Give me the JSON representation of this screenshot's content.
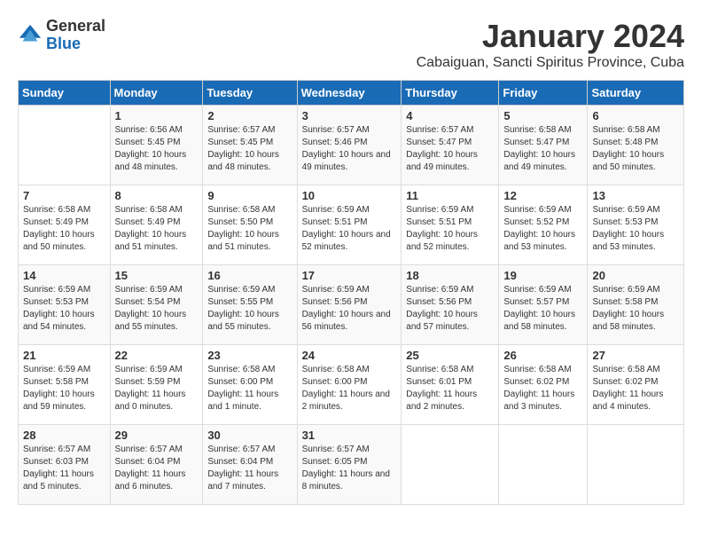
{
  "logo": {
    "general": "General",
    "blue": "Blue"
  },
  "title": "January 2024",
  "subtitle": "Cabaiguan, Sancti Spiritus Province, Cuba",
  "days_header": [
    "Sunday",
    "Monday",
    "Tuesday",
    "Wednesday",
    "Thursday",
    "Friday",
    "Saturday"
  ],
  "weeks": [
    [
      {
        "day": "",
        "sunrise": "",
        "sunset": "",
        "daylight": ""
      },
      {
        "day": "1",
        "sunrise": "Sunrise: 6:56 AM",
        "sunset": "Sunset: 5:45 PM",
        "daylight": "Daylight: 10 hours and 48 minutes."
      },
      {
        "day": "2",
        "sunrise": "Sunrise: 6:57 AM",
        "sunset": "Sunset: 5:45 PM",
        "daylight": "Daylight: 10 hours and 48 minutes."
      },
      {
        "day": "3",
        "sunrise": "Sunrise: 6:57 AM",
        "sunset": "Sunset: 5:46 PM",
        "daylight": "Daylight: 10 hours and 49 minutes."
      },
      {
        "day": "4",
        "sunrise": "Sunrise: 6:57 AM",
        "sunset": "Sunset: 5:47 PM",
        "daylight": "Daylight: 10 hours and 49 minutes."
      },
      {
        "day": "5",
        "sunrise": "Sunrise: 6:58 AM",
        "sunset": "Sunset: 5:47 PM",
        "daylight": "Daylight: 10 hours and 49 minutes."
      },
      {
        "day": "6",
        "sunrise": "Sunrise: 6:58 AM",
        "sunset": "Sunset: 5:48 PM",
        "daylight": "Daylight: 10 hours and 50 minutes."
      }
    ],
    [
      {
        "day": "7",
        "sunrise": "Sunrise: 6:58 AM",
        "sunset": "Sunset: 5:49 PM",
        "daylight": "Daylight: 10 hours and 50 minutes."
      },
      {
        "day": "8",
        "sunrise": "Sunrise: 6:58 AM",
        "sunset": "Sunset: 5:49 PM",
        "daylight": "Daylight: 10 hours and 51 minutes."
      },
      {
        "day": "9",
        "sunrise": "Sunrise: 6:58 AM",
        "sunset": "Sunset: 5:50 PM",
        "daylight": "Daylight: 10 hours and 51 minutes."
      },
      {
        "day": "10",
        "sunrise": "Sunrise: 6:59 AM",
        "sunset": "Sunset: 5:51 PM",
        "daylight": "Daylight: 10 hours and 52 minutes."
      },
      {
        "day": "11",
        "sunrise": "Sunrise: 6:59 AM",
        "sunset": "Sunset: 5:51 PM",
        "daylight": "Daylight: 10 hours and 52 minutes."
      },
      {
        "day": "12",
        "sunrise": "Sunrise: 6:59 AM",
        "sunset": "Sunset: 5:52 PM",
        "daylight": "Daylight: 10 hours and 53 minutes."
      },
      {
        "day": "13",
        "sunrise": "Sunrise: 6:59 AM",
        "sunset": "Sunset: 5:53 PM",
        "daylight": "Daylight: 10 hours and 53 minutes."
      }
    ],
    [
      {
        "day": "14",
        "sunrise": "Sunrise: 6:59 AM",
        "sunset": "Sunset: 5:53 PM",
        "daylight": "Daylight: 10 hours and 54 minutes."
      },
      {
        "day": "15",
        "sunrise": "Sunrise: 6:59 AM",
        "sunset": "Sunset: 5:54 PM",
        "daylight": "Daylight: 10 hours and 55 minutes."
      },
      {
        "day": "16",
        "sunrise": "Sunrise: 6:59 AM",
        "sunset": "Sunset: 5:55 PM",
        "daylight": "Daylight: 10 hours and 55 minutes."
      },
      {
        "day": "17",
        "sunrise": "Sunrise: 6:59 AM",
        "sunset": "Sunset: 5:56 PM",
        "daylight": "Daylight: 10 hours and 56 minutes."
      },
      {
        "day": "18",
        "sunrise": "Sunrise: 6:59 AM",
        "sunset": "Sunset: 5:56 PM",
        "daylight": "Daylight: 10 hours and 57 minutes."
      },
      {
        "day": "19",
        "sunrise": "Sunrise: 6:59 AM",
        "sunset": "Sunset: 5:57 PM",
        "daylight": "Daylight: 10 hours and 58 minutes."
      },
      {
        "day": "20",
        "sunrise": "Sunrise: 6:59 AM",
        "sunset": "Sunset: 5:58 PM",
        "daylight": "Daylight: 10 hours and 58 minutes."
      }
    ],
    [
      {
        "day": "21",
        "sunrise": "Sunrise: 6:59 AM",
        "sunset": "Sunset: 5:58 PM",
        "daylight": "Daylight: 10 hours and 59 minutes."
      },
      {
        "day": "22",
        "sunrise": "Sunrise: 6:59 AM",
        "sunset": "Sunset: 5:59 PM",
        "daylight": "Daylight: 11 hours and 0 minutes."
      },
      {
        "day": "23",
        "sunrise": "Sunrise: 6:58 AM",
        "sunset": "Sunset: 6:00 PM",
        "daylight": "Daylight: 11 hours and 1 minute."
      },
      {
        "day": "24",
        "sunrise": "Sunrise: 6:58 AM",
        "sunset": "Sunset: 6:00 PM",
        "daylight": "Daylight: 11 hours and 2 minutes."
      },
      {
        "day": "25",
        "sunrise": "Sunrise: 6:58 AM",
        "sunset": "Sunset: 6:01 PM",
        "daylight": "Daylight: 11 hours and 2 minutes."
      },
      {
        "day": "26",
        "sunrise": "Sunrise: 6:58 AM",
        "sunset": "Sunset: 6:02 PM",
        "daylight": "Daylight: 11 hours and 3 minutes."
      },
      {
        "day": "27",
        "sunrise": "Sunrise: 6:58 AM",
        "sunset": "Sunset: 6:02 PM",
        "daylight": "Daylight: 11 hours and 4 minutes."
      }
    ],
    [
      {
        "day": "28",
        "sunrise": "Sunrise: 6:57 AM",
        "sunset": "Sunset: 6:03 PM",
        "daylight": "Daylight: 11 hours and 5 minutes."
      },
      {
        "day": "29",
        "sunrise": "Sunrise: 6:57 AM",
        "sunset": "Sunset: 6:04 PM",
        "daylight": "Daylight: 11 hours and 6 minutes."
      },
      {
        "day": "30",
        "sunrise": "Sunrise: 6:57 AM",
        "sunset": "Sunset: 6:04 PM",
        "daylight": "Daylight: 11 hours and 7 minutes."
      },
      {
        "day": "31",
        "sunrise": "Sunrise: 6:57 AM",
        "sunset": "Sunset: 6:05 PM",
        "daylight": "Daylight: 11 hours and 8 minutes."
      },
      {
        "day": "",
        "sunrise": "",
        "sunset": "",
        "daylight": ""
      },
      {
        "day": "",
        "sunrise": "",
        "sunset": "",
        "daylight": ""
      },
      {
        "day": "",
        "sunrise": "",
        "sunset": "",
        "daylight": ""
      }
    ]
  ]
}
